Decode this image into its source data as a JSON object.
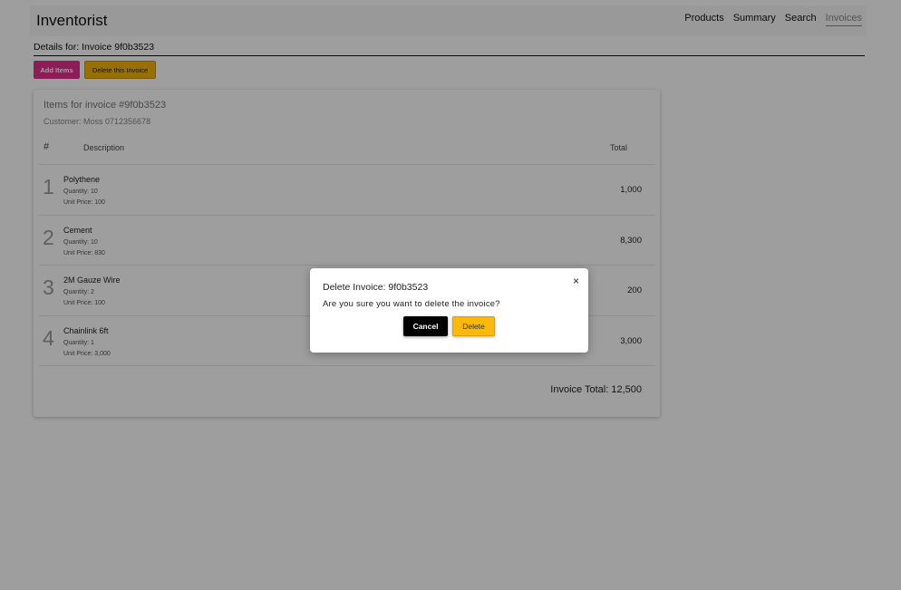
{
  "header": {
    "brand": "Inventorist",
    "nav": [
      "Products",
      "Summary",
      "Search",
      "Invoices"
    ],
    "active_nav": "Invoices"
  },
  "page": {
    "details_title": "Details for: Invoice 9f0b3523",
    "add_items_label": "Add Items",
    "delete_invoice_label": "Delete this Invoice"
  },
  "card": {
    "title": "Items for invoice #9f0b3523",
    "customer": "Customer: Moss 0712356678",
    "columns": {
      "number": "#",
      "description": "Description",
      "total": "Total"
    },
    "items": [
      {
        "num": "1",
        "name": "Polythene",
        "quantity": "Quantity: 10",
        "unit_price": "Unit Price: 100",
        "total": "1,000"
      },
      {
        "num": "2",
        "name": "Cement",
        "quantity": "Quantity: 10",
        "unit_price": "Unit Price: 830",
        "total": "8,300"
      },
      {
        "num": "3",
        "name": "2M Gauze Wire",
        "quantity": "Quantity: 2",
        "unit_price": "Unit Price: 100",
        "total": "200"
      },
      {
        "num": "4",
        "name": "Chainlink 6ft",
        "quantity": "Quantity: 1",
        "unit_price": "Unit Price: 3,000",
        "total": "3,000"
      }
    ],
    "invoice_total": "Invoice Total: 12,500"
  },
  "modal": {
    "title": "Delete Invoice: 9f0b3523",
    "message": "Are you sure you want to delete the invoice?",
    "cancel_label": "Cancel",
    "delete_label": "Delete",
    "close_glyph": "×"
  },
  "colors": {
    "add_button": "#e3308e",
    "delete_button": "#f5b400",
    "cancel_button": "#000000",
    "overlay": "rgba(0,0,0,0.38)"
  }
}
